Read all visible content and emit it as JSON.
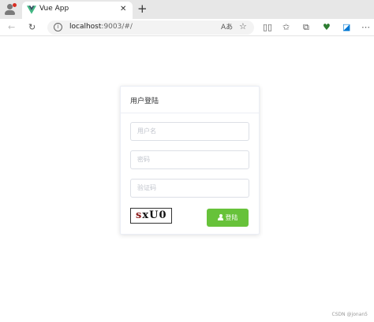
{
  "browser": {
    "tab_title": "Vue App",
    "tab_close": "✕",
    "new_tab": "+",
    "url_host": "localhost",
    "url_rest": ":9003/#/",
    "info_icon_glyph": "i"
  },
  "login": {
    "title": "用户登陆",
    "username_placeholder": "用户名",
    "password_placeholder": "密码",
    "captcha_placeholder": "验证码",
    "captcha_chars": [
      "s",
      "x",
      "U",
      "0"
    ],
    "button_label": "登陆",
    "button_color": "#67c23a"
  },
  "watermark": "CSDN @jonan5"
}
